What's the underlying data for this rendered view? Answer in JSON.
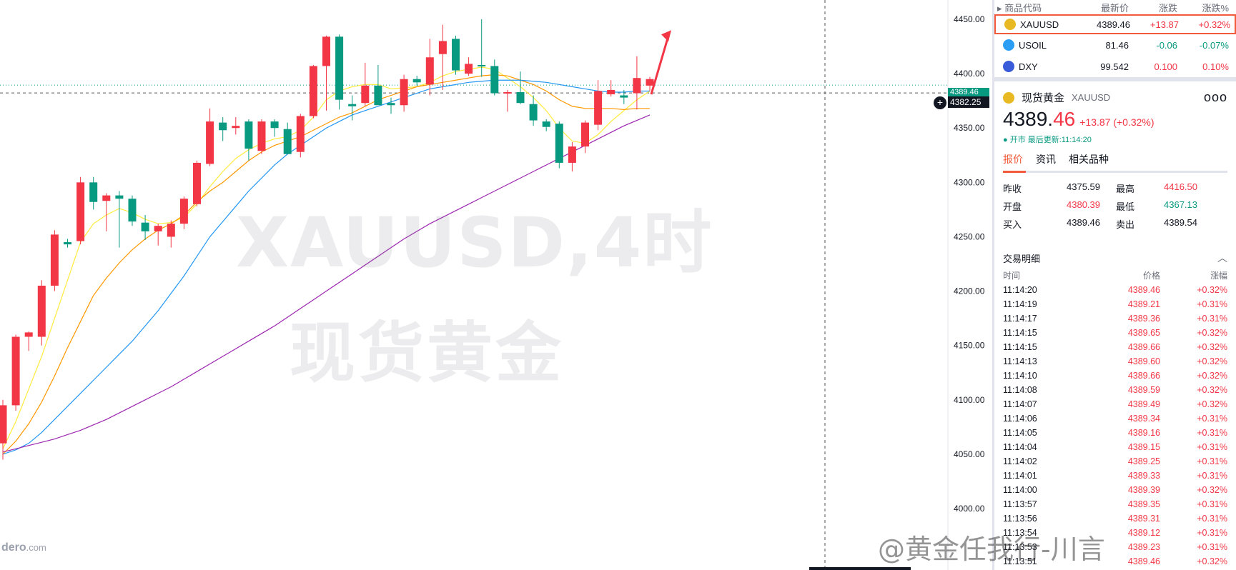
{
  "chart_data": {
    "type": "candlestick",
    "watermark_line1": "XAUUSD,4时",
    "watermark_line2": "现货黄金",
    "ylim": [
      4000,
      4450
    ],
    "y_ticks": [
      "4450.00",
      "4400.00",
      "4350.00",
      "4300.00",
      "4250.00",
      "4200.00",
      "4150.00",
      "4100.00",
      "4050.00",
      "4000.00"
    ],
    "y_tick_values": [
      4450,
      4400,
      4350,
      4300,
      4250,
      4200,
      4150,
      4100,
      4050,
      4000
    ],
    "last_price_label": "4389.46",
    "crosshair_price_label": "4382.25",
    "last_price": 4389.46,
    "crosshair_price": 4382.25,
    "candles": [
      {
        "o": 4060,
        "h": 4100,
        "l": 4045,
        "c": 4095
      },
      {
        "o": 4095,
        "h": 4160,
        "l": 4090,
        "c": 4158
      },
      {
        "o": 4158,
        "h": 4163,
        "l": 4145,
        "c": 4162
      },
      {
        "o": 4158,
        "h": 4210,
        "l": 4150,
        "c": 4205
      },
      {
        "o": 4205,
        "h": 4256,
        "l": 4200,
        "c": 4252
      },
      {
        "o": 4245,
        "h": 4248,
        "l": 4240,
        "c": 4243
      },
      {
        "o": 4246,
        "h": 4305,
        "l": 4243,
        "c": 4300
      },
      {
        "o": 4300,
        "h": 4305,
        "l": 4275,
        "c": 4282
      },
      {
        "o": 4283,
        "h": 4290,
        "l": 4255,
        "c": 4288
      },
      {
        "o": 4288,
        "h": 4292,
        "l": 4240,
        "c": 4285
      },
      {
        "o": 4285,
        "h": 4288,
        "l": 4260,
        "c": 4264
      },
      {
        "o": 4263,
        "h": 4270,
        "l": 4247,
        "c": 4255
      },
      {
        "o": 4255,
        "h": 4262,
        "l": 4242,
        "c": 4260
      },
      {
        "o": 4250,
        "h": 4265,
        "l": 4240,
        "c": 4262
      },
      {
        "o": 4262,
        "h": 4287,
        "l": 4257,
        "c": 4285
      },
      {
        "o": 4280,
        "h": 4320,
        "l": 4278,
        "c": 4318
      },
      {
        "o": 4317,
        "h": 4368,
        "l": 4315,
        "c": 4356
      },
      {
        "o": 4355,
        "h": 4360,
        "l": 4338,
        "c": 4348
      },
      {
        "o": 4350,
        "h": 4360,
        "l": 4344,
        "c": 4352
      },
      {
        "o": 4356,
        "h": 4358,
        "l": 4320,
        "c": 4331
      },
      {
        "o": 4329,
        "h": 4358,
        "l": 4326,
        "c": 4356
      },
      {
        "o": 4356,
        "h": 4358,
        "l": 4342,
        "c": 4350
      },
      {
        "o": 4349,
        "h": 4355,
        "l": 4327,
        "c": 4326
      },
      {
        "o": 4328,
        "h": 4363,
        "l": 4323,
        "c": 4361
      },
      {
        "o": 4361,
        "h": 4408,
        "l": 4359,
        "c": 4407
      },
      {
        "o": 4407,
        "h": 4435,
        "l": 4366,
        "c": 4434
      },
      {
        "o": 4434,
        "h": 4436,
        "l": 4367,
        "c": 4376
      },
      {
        "o": 4372,
        "h": 4380,
        "l": 4357,
        "c": 4370
      },
      {
        "o": 4373,
        "h": 4410,
        "l": 4370,
        "c": 4389
      },
      {
        "o": 4389,
        "h": 4408,
        "l": 4372,
        "c": 4371
      },
      {
        "o": 4373,
        "h": 4378,
        "l": 4363,
        "c": 4371
      },
      {
        "o": 4371,
        "h": 4399,
        "l": 4365,
        "c": 4395
      },
      {
        "o": 4395,
        "h": 4398,
        "l": 4389,
        "c": 4392
      },
      {
        "o": 4390,
        "h": 4432,
        "l": 4380,
        "c": 4415
      },
      {
        "o": 4418,
        "h": 4445,
        "l": 4385,
        "c": 4430
      },
      {
        "o": 4432,
        "h": 4435,
        "l": 4399,
        "c": 4403
      },
      {
        "o": 4400,
        "h": 4415,
        "l": 4398,
        "c": 4409
      },
      {
        "o": 4408,
        "h": 4450,
        "l": 4397,
        "c": 4407
      },
      {
        "o": 4407,
        "h": 4413,
        "l": 4380,
        "c": 4382
      },
      {
        "o": 4382,
        "h": 4385,
        "l": 4365,
        "c": 4383
      },
      {
        "o": 4383,
        "h": 4402,
        "l": 4372,
        "c": 4373
      },
      {
        "o": 4372,
        "h": 4380,
        "l": 4352,
        "c": 4357
      },
      {
        "o": 4356,
        "h": 4358,
        "l": 4347,
        "c": 4351
      },
      {
        "o": 4354,
        "h": 4356,
        "l": 4313,
        "c": 4318
      },
      {
        "o": 4318,
        "h": 4337,
        "l": 4310,
        "c": 4333
      },
      {
        "o": 4333,
        "h": 4357,
        "l": 4327,
        "c": 4355
      },
      {
        "o": 4353,
        "h": 4394,
        "l": 4348,
        "c": 4384
      },
      {
        "o": 4381,
        "h": 4394,
        "l": 4379,
        "c": 4385
      },
      {
        "o": 4380,
        "h": 4385,
        "l": 4372,
        "c": 4378
      },
      {
        "o": 4382,
        "h": 4416,
        "l": 4367,
        "c": 4396
      },
      {
        "o": 4389,
        "h": 4397,
        "l": 4384,
        "c": 4395
      }
    ],
    "ma_series": [
      {
        "color": "#ffeb3b",
        "values": [
          4055,
          4080,
          4110,
          4140,
          4175,
          4210,
          4245,
          4262,
          4270,
          4276,
          4272,
          4266,
          4262,
          4263,
          4268,
          4280,
          4296,
          4310,
          4322,
          4330,
          4336,
          4340,
          4342,
          4348,
          4360,
          4376,
          4384,
          4388,
          4390,
          4390,
          4386,
          4387,
          4388,
          4392,
          4398,
          4402,
          4404,
          4406,
          4404,
          4396,
          4388,
          4378,
          4366,
          4350,
          4338,
          4336,
          4344,
          4356,
          4366,
          4376,
          4384
        ]
      },
      {
        "color": "#ff9800",
        "values": [
          4050,
          4062,
          4078,
          4098,
          4122,
          4148,
          4172,
          4196,
          4212,
          4226,
          4238,
          4248,
          4256,
          4262,
          4270,
          4282,
          4292,
          4300,
          4310,
          4320,
          4328,
          4334,
          4338,
          4342,
          4348,
          4354,
          4360,
          4364,
          4370,
          4376,
          4380,
          4384,
          4388,
          4390,
          4392,
          4394,
          4396,
          4398,
          4399,
          4398,
          4394,
          4390,
          4384,
          4376,
          4370,
          4368,
          4368,
          4368,
          4367,
          4368,
          4368
        ]
      },
      {
        "color": "#2196f3",
        "values": [
          4050,
          4054,
          4060,
          4070,
          4082,
          4094,
          4106,
          4118,
          4130,
          4142,
          4154,
          4168,
          4182,
          4198,
          4214,
          4232,
          4250,
          4264,
          4278,
          4292,
          4304,
          4316,
          4326,
          4334,
          4342,
          4350,
          4356,
          4362,
          4366,
          4370,
          4374,
          4378,
          4382,
          4386,
          4388,
          4390,
          4392,
          4393,
          4394,
          4394,
          4394,
          4393,
          4392,
          4390,
          4388,
          4386,
          4384,
          4383,
          4383,
          4384,
          4384
        ]
      },
      {
        "color": "#9c27b0",
        "values": [
          4052,
          4055,
          4058,
          4061,
          4064,
          4068,
          4072,
          4077,
          4082,
          4088,
          4094,
          4100,
          4106,
          4112,
          4119,
          4126,
          4133,
          4140,
          4147,
          4154,
          4161,
          4168,
          4176,
          4184,
          4192,
          4200,
          4208,
          4216,
          4224,
          4232,
          4240,
          4248,
          4255,
          4262,
          4268,
          4274,
          4280,
          4286,
          4292,
          4298,
          4304,
          4310,
          4316,
          4322,
          4328,
          4334,
          4340,
          4346,
          4352,
          4357,
          4362
        ]
      }
    ]
  },
  "brand": {
    "main": "dero",
    "suffix": ".com"
  },
  "panel": {
    "watchlist": {
      "headers": [
        "商品代码",
        "最新价",
        "涨跌",
        "涨跌%"
      ],
      "rows": [
        {
          "symbol": "XAUUSD",
          "last": "4389.46",
          "change": "+13.87",
          "pct": "+0.32%",
          "color": "#e8b923",
          "dir": "up"
        },
        {
          "symbol": "USOIL",
          "last": "81.46",
          "change": "-0.06",
          "pct": "-0.07%",
          "color": "#2a9df4",
          "dir": "dn"
        },
        {
          "symbol": "DXY",
          "last": "99.542",
          "change": "0.100",
          "pct": "0.10%",
          "color": "#3a5bd9",
          "dir": "up"
        }
      ]
    },
    "detail": {
      "title": "现货黄金",
      "symbol": "XAUUSD",
      "more": "ooo",
      "price_int": "4389.",
      "price_dec": "46",
      "change": "+13.87 (+0.32%)",
      "status": "● 开市  最后更新:11:14:20",
      "tabs": [
        "报价",
        "资讯",
        "相关品种"
      ]
    },
    "quotes": [
      {
        "label": "昨收",
        "value": "4375.59",
        "label2": "最高",
        "value2": "4416.50",
        "c1": "#131722",
        "c2": "#f23645"
      },
      {
        "label": "开盘",
        "value": "4380.39",
        "label2": "最低",
        "value2": "4367.13",
        "c1": "#f23645",
        "c2": "#089981"
      },
      {
        "label": "买入",
        "value": "4389.46",
        "label2": "卖出",
        "value2": "4389.54",
        "c1": "#131722",
        "c2": "#131722"
      }
    ],
    "trades": {
      "title": "交易明细",
      "chevron": "︿",
      "headers": [
        "时间",
        "价格",
        "涨幅"
      ],
      "rows": [
        {
          "t": "11:14:20",
          "p": "4389.46",
          "c": "+0.32%"
        },
        {
          "t": "11:14:19",
          "p": "4389.21",
          "c": "+0.31%"
        },
        {
          "t": "11:14:17",
          "p": "4389.36",
          "c": "+0.31%"
        },
        {
          "t": "11:14:15",
          "p": "4389.65",
          "c": "+0.32%"
        },
        {
          "t": "11:14:15",
          "p": "4389.66",
          "c": "+0.32%"
        },
        {
          "t": "11:14:13",
          "p": "4389.60",
          "c": "+0.32%"
        },
        {
          "t": "11:14:10",
          "p": "4389.66",
          "c": "+0.32%"
        },
        {
          "t": "11:14:08",
          "p": "4389.59",
          "c": "+0.32%"
        },
        {
          "t": "11:14:07",
          "p": "4389.49",
          "c": "+0.32%"
        },
        {
          "t": "11:14:06",
          "p": "4389.34",
          "c": "+0.31%"
        },
        {
          "t": "11:14:05",
          "p": "4389.16",
          "c": "+0.31%"
        },
        {
          "t": "11:14:04",
          "p": "4389.15",
          "c": "+0.31%"
        },
        {
          "t": "11:14:02",
          "p": "4389.25",
          "c": "+0.31%"
        },
        {
          "t": "11:14:01",
          "p": "4389.33",
          "c": "+0.31%"
        },
        {
          "t": "11:14:00",
          "p": "4389.39",
          "c": "+0.32%"
        },
        {
          "t": "11:13:57",
          "p": "4389.35",
          "c": "+0.31%"
        },
        {
          "t": "11:13:56",
          "p": "4389.31",
          "c": "+0.31%"
        },
        {
          "t": "11:13:54",
          "p": "4389.12",
          "c": "+0.31%"
        },
        {
          "t": "11:13:53",
          "p": "4389.23",
          "c": "+0.31%"
        },
        {
          "t": "11:13:51",
          "p": "4389.46",
          "c": "+0.32%"
        }
      ]
    }
  },
  "overlay_watermark": "@黄金任我行-川言",
  "colors": {
    "up": "#f23645",
    "down": "#089981",
    "accent": "#f15a3a"
  }
}
